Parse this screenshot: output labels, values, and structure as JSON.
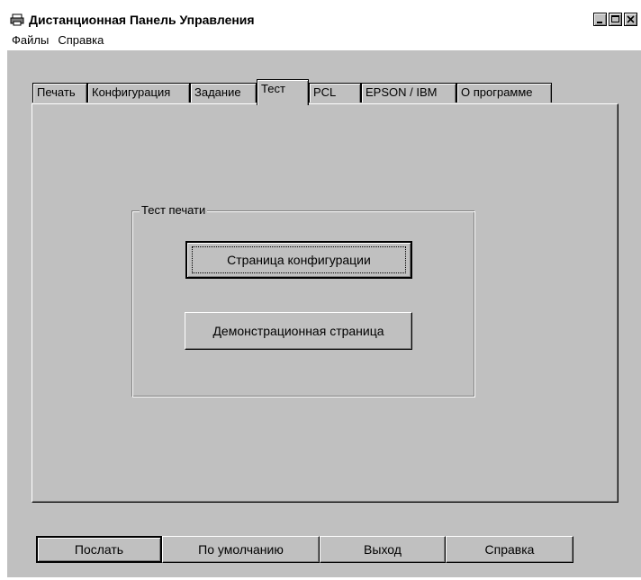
{
  "window": {
    "title": "Дистанционная Панель Управления",
    "app_icon": "printer-icon",
    "controls": [
      "minimize-icon",
      "maximize-icon",
      "close-icon"
    ]
  },
  "menu": {
    "items": [
      "Файлы",
      "Справка"
    ]
  },
  "tabs": {
    "items": [
      "Печать",
      "Конфигурация",
      "Задание",
      "Тест",
      "PCL",
      "EPSON / IBM",
      "О программе"
    ],
    "active": "Тест"
  },
  "test_group": {
    "label": "Тест печати",
    "config_page_button": "Страница конфигурации",
    "demo_page_button": "Демонстрационная страница"
  },
  "footer": {
    "send": "Послать",
    "default": "По умолчанию",
    "exit": "Выход",
    "help": "Справка"
  }
}
